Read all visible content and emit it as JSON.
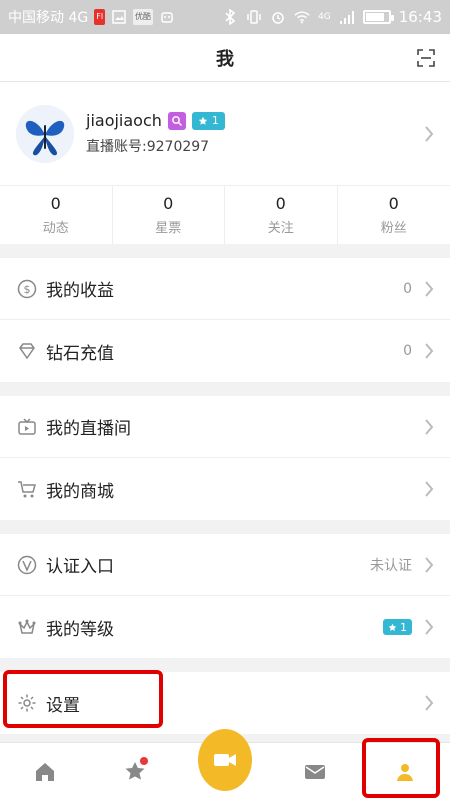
{
  "status_bar": {
    "carrier": "中国移动 4G",
    "time": "16:43",
    "network": "4G",
    "battery_level": 0.75,
    "notification_icons": [
      "news-app-icon",
      "image-icon",
      "youku-app-icon",
      "android-icon"
    ],
    "right_icons": [
      "bluetooth-icon",
      "vibrate-icon",
      "alarm-icon",
      "wifi-icon",
      "signal-icon",
      "battery-icon"
    ]
  },
  "header": {
    "title": "我",
    "scan_icon": "scan-icon"
  },
  "profile": {
    "username": "jiaojiaoch",
    "live_id": "直播账号:9270297",
    "level": "1",
    "badge_icon": "search-badge-icon",
    "avatar_icon": "butterfly-avatar"
  },
  "stats": [
    {
      "value": "0",
      "label": "动态"
    },
    {
      "value": "0",
      "label": "星票"
    },
    {
      "value": "0",
      "label": "关注"
    },
    {
      "value": "0",
      "label": "粉丝"
    }
  ],
  "menu": {
    "earnings": {
      "label": "我的收益",
      "value": "0",
      "icon": "dollar-icon"
    },
    "recharge": {
      "label": "钻石充值",
      "value": "0",
      "icon": "diamond-icon"
    },
    "live_room": {
      "label": "我的直播间",
      "icon": "tv-icon"
    },
    "mall": {
      "label": "我的商城",
      "icon": "cart-icon"
    },
    "verify": {
      "label": "认证入口",
      "value": "未认证",
      "icon": "verify-icon"
    },
    "level": {
      "label": "我的等级",
      "level": "1",
      "icon": "crown-icon"
    },
    "settings": {
      "label": "设置",
      "icon": "gear-icon"
    }
  },
  "bottom_nav": [
    {
      "name": "home-tab",
      "icon": "home-icon"
    },
    {
      "name": "star-tab",
      "icon": "star-icon",
      "has_dot": true
    },
    {
      "name": "live-tab",
      "icon": "camera-icon"
    },
    {
      "name": "message-tab",
      "icon": "mail-icon"
    },
    {
      "name": "me-tab",
      "icon": "person-icon",
      "active": true
    }
  ],
  "colors": {
    "accent": "#f4b927",
    "level_badge": "#33b7d3",
    "purple_badge": "#c35ee0",
    "highlight_red": "#e10000"
  }
}
